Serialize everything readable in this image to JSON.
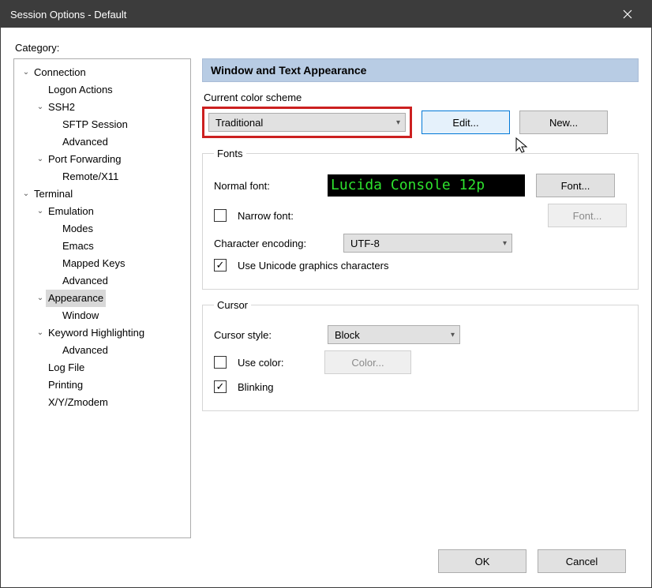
{
  "window": {
    "title": "Session Options - Default"
  },
  "category_label": "Category:",
  "tree": [
    {
      "level": 0,
      "expander": "v",
      "label": "Connection"
    },
    {
      "level": 1,
      "expander": "",
      "label": "Logon Actions"
    },
    {
      "level": 1,
      "expander": "v",
      "label": "SSH2"
    },
    {
      "level": 2,
      "expander": "",
      "label": "SFTP Session"
    },
    {
      "level": 2,
      "expander": "",
      "label": "Advanced"
    },
    {
      "level": 1,
      "expander": "v",
      "label": "Port Forwarding"
    },
    {
      "level": 2,
      "expander": "",
      "label": "Remote/X11"
    },
    {
      "level": 0,
      "expander": "v",
      "label": "Terminal"
    },
    {
      "level": 1,
      "expander": "v",
      "label": "Emulation"
    },
    {
      "level": 2,
      "expander": "",
      "label": "Modes"
    },
    {
      "level": 2,
      "expander": "",
      "label": "Emacs"
    },
    {
      "level": 2,
      "expander": "",
      "label": "Mapped Keys"
    },
    {
      "level": 2,
      "expander": "",
      "label": "Advanced"
    },
    {
      "level": 1,
      "expander": "v",
      "label": "Appearance",
      "selected": true
    },
    {
      "level": 2,
      "expander": "",
      "label": "Window"
    },
    {
      "level": 1,
      "expander": "v",
      "label": "Keyword Highlighting"
    },
    {
      "level": 2,
      "expander": "",
      "label": "Advanced"
    },
    {
      "level": 1,
      "expander": "",
      "label": "Log File"
    },
    {
      "level": 1,
      "expander": "",
      "label": "Printing"
    },
    {
      "level": 1,
      "expander": "",
      "label": "X/Y/Zmodem"
    }
  ],
  "panel": {
    "header": "Window and Text Appearance",
    "scheme_label": "Current color scheme",
    "scheme_value": "Traditional",
    "edit": "Edit...",
    "new": "New..."
  },
  "fonts": {
    "group": "Fonts",
    "normal_label": "Normal font:",
    "preview": "Lucida Console 12p",
    "font_btn": "Font...",
    "narrow_label": "Narrow font:",
    "font_btn_disabled": "Font...",
    "encoding_label": "Character encoding:",
    "encoding_value": "UTF-8",
    "unicode_label": "Use Unicode graphics characters"
  },
  "cursor": {
    "group": "Cursor",
    "style_label": "Cursor style:",
    "style_value": "Block",
    "use_color": "Use color:",
    "color_btn": "Color...",
    "blinking": "Blinking"
  },
  "footer": {
    "ok": "OK",
    "cancel": "Cancel"
  }
}
